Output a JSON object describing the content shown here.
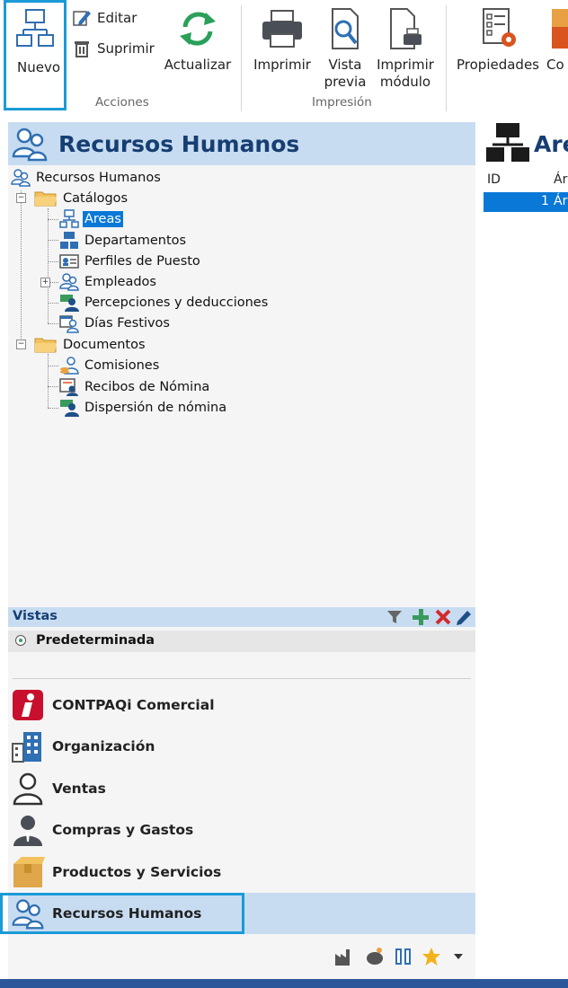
{
  "ribbon": {
    "nuevo": "Nuevo",
    "editar": "Editar",
    "suprimir": "Suprimir",
    "actualizar": "Actualizar",
    "acciones_group": "Acciones",
    "imprimir": "Imprimir",
    "vista_previa_1": "Vista",
    "vista_previa_2": "previa",
    "imprimir_modulo_1": "Imprimir",
    "imprimir_modulo_2": "módulo",
    "impresion_group": "Impresión",
    "propiedades": "Propiedades",
    "cortado": "Co"
  },
  "nav": {
    "title": "Recursos Humanos",
    "tree": {
      "root": "Recursos Humanos",
      "catalogos": "Catálogos",
      "areas": "Areas",
      "departamentos": "Departamentos",
      "perfiles": "Perfiles de Puesto",
      "empleados": "Empleados",
      "percepciones": "Percepciones y deducciones",
      "festivos": "Días Festivos",
      "documentos": "Documentos",
      "comisiones": "Comisiones",
      "recibos": "Recibos de Nómina",
      "dispersion": "Dispersión de nómina"
    },
    "vistas_label": "Vistas",
    "vista_selected": "Predeterminada",
    "modules": [
      "CONTPAQi Comercial",
      "Organización",
      "Ventas",
      "Compras y Gastos",
      "Productos y Servicios",
      "Recursos Humanos"
    ]
  },
  "right": {
    "title_cut": "Are",
    "col_id": "ID",
    "col_area_cut": "Ár",
    "row1_id": "1",
    "row1_area_cut": "Ár"
  },
  "colors": {
    "accent_blue": "#1a9ad6",
    "header_blue": "#c7dcf1",
    "selection_blue": "#0a78d7",
    "status_bar": "#2b579a"
  },
  "icons": [
    "org-chart-icon",
    "edit-icon",
    "trash-icon",
    "refresh-icon",
    "printer-icon",
    "print-preview-icon",
    "print-module-icon",
    "properties-icon",
    "people-icon",
    "folder-icon",
    "filter-icon",
    "plus-icon",
    "delete-x-icon",
    "pencil-icon",
    "radio-icon",
    "contpaqi-icon",
    "building-icon",
    "person-icon",
    "manager-icon",
    "box-icon",
    "bottom-icons",
    "star-icon",
    "dropdown-icon"
  ]
}
